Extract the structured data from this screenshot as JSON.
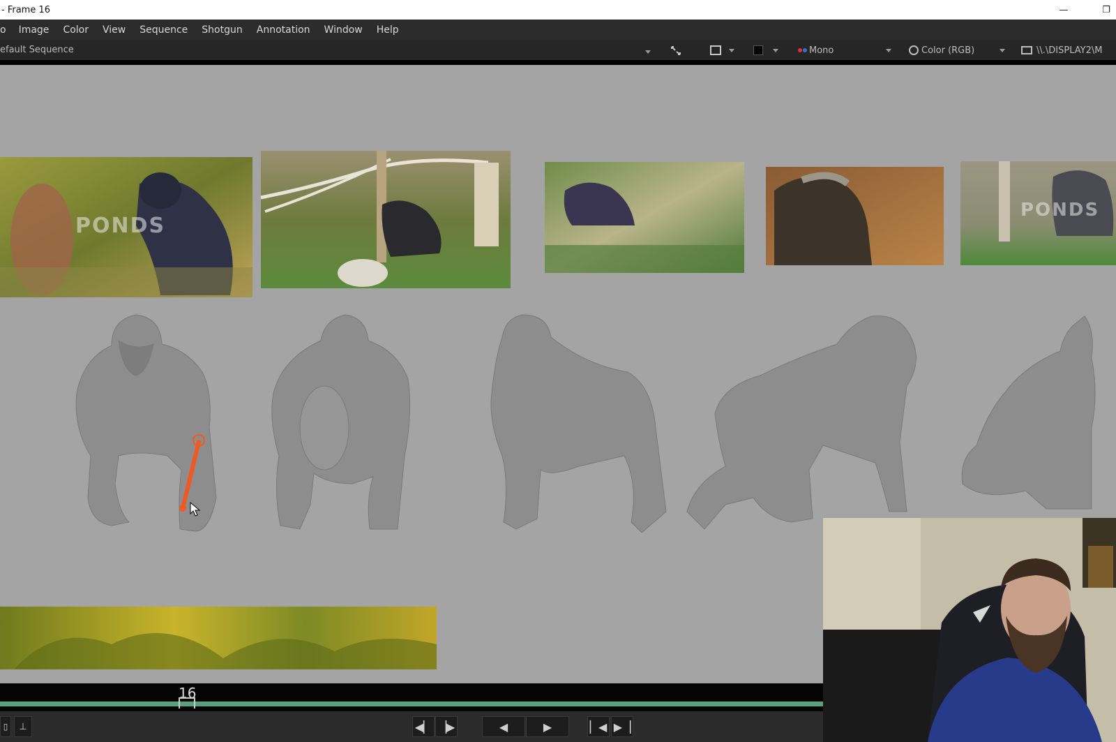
{
  "window": {
    "title": "- Frame 16",
    "minimize_glyph": "—",
    "restore_glyph": "❐"
  },
  "menu": {
    "items": [
      "o",
      "Image",
      "Color",
      "View",
      "Sequence",
      "Shotgun",
      "Annotation",
      "Window",
      "Help"
    ]
  },
  "toolbar": {
    "sequence_label": "efault Sequence",
    "channel_label": "Mono",
    "color_label": "Color (RGB)",
    "display_label": "\\\\.\\DISPLAY2\\M"
  },
  "viewer": {
    "background": "#a4a4a4",
    "watermarks": [
      "PONDS",
      "PONDS"
    ],
    "annotation_color": "#f05a22"
  },
  "timeline": {
    "current_frame": "16",
    "bar_color": "#5a9f7e"
  },
  "icons": [
    "restore-icon",
    "minimize-icon",
    "dropdown-arrow-icon",
    "fit-icon",
    "crop-icon",
    "background-swatch-icon",
    "channel-dots-icon",
    "color-circle-icon",
    "monitor-icon",
    "step-back-icon",
    "step-forward-icon",
    "play-reverse-icon",
    "play-icon",
    "go-start-icon",
    "go-end-icon",
    "mouse-cursor-icon"
  ]
}
